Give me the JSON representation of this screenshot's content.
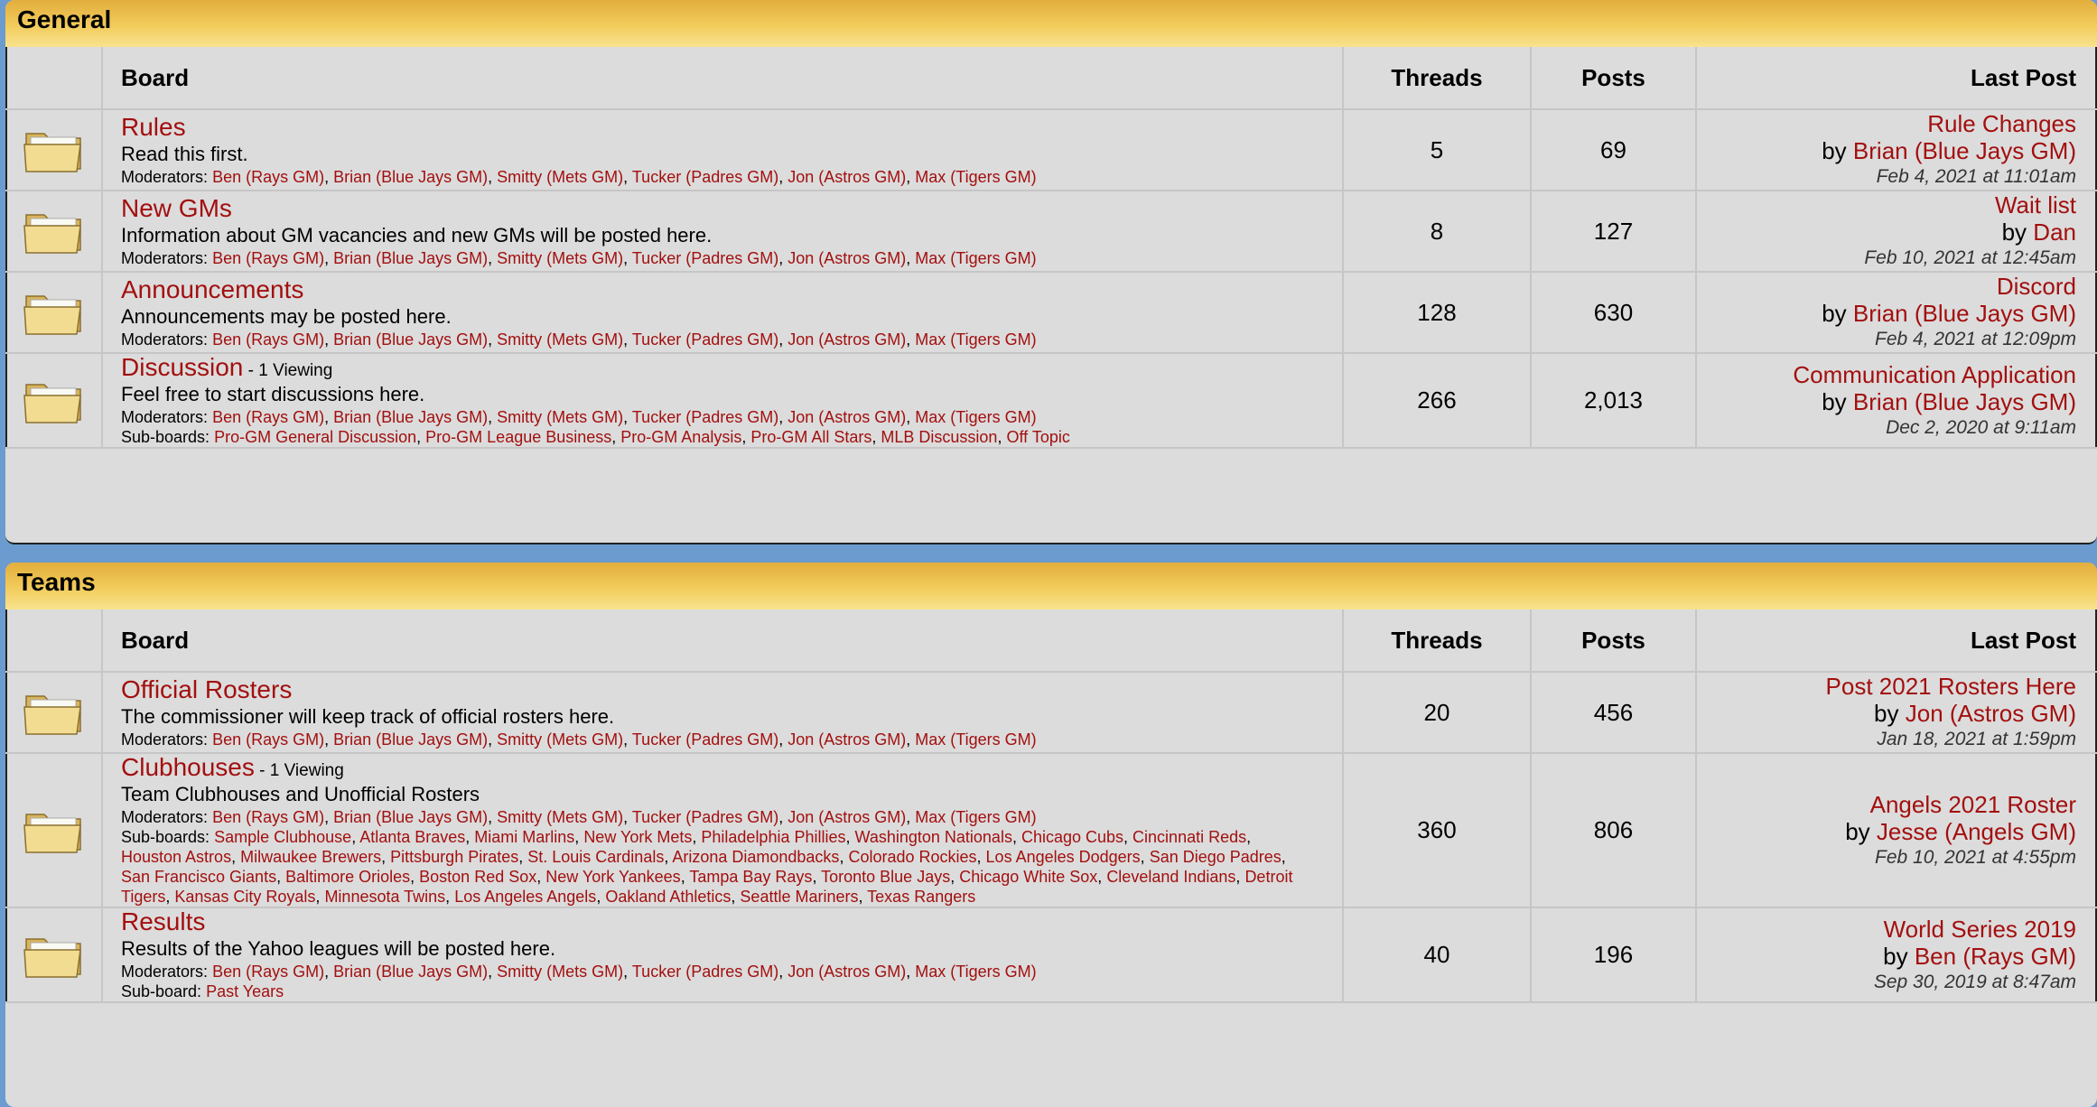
{
  "colors": {
    "link": "#a30f0f",
    "header_gold": "#f2cc5c",
    "background_blue": "#6b9bcf",
    "table_gray": "#dcdcdc"
  },
  "icons": {
    "board_icon": "folder-icon"
  },
  "labels": {
    "board": "Board",
    "threads": "Threads",
    "posts": "Posts",
    "last_post": "Last Post",
    "by": "by",
    "moderators": "Moderators:",
    "subboards": "Sub-boards:",
    "subboard": "Sub-board:"
  },
  "categories": [
    {
      "title": "General",
      "boards": [
        {
          "title": "Rules",
          "viewing": "",
          "description": "Read this first.",
          "moderators": [
            "Ben (Rays GM)",
            "Brian (Blue Jays GM)",
            "Smitty (Mets GM)",
            "Tucker (Padres GM)",
            "Jon (Astros GM)",
            "Max (Tigers GM)"
          ],
          "subboards_label": "",
          "subboards": [],
          "threads": "5",
          "posts": "69",
          "last_post": {
            "title": "Rule Changes",
            "author": "Brian (Blue Jays GM)",
            "date": "Feb 4, 2021 at 11:01am"
          }
        },
        {
          "title": "New GMs",
          "viewing": "",
          "description": "Information about GM vacancies and new GMs will be posted here.",
          "moderators": [
            "Ben (Rays GM)",
            "Brian (Blue Jays GM)",
            "Smitty (Mets GM)",
            "Tucker (Padres GM)",
            "Jon (Astros GM)",
            "Max (Tigers GM)"
          ],
          "subboards_label": "",
          "subboards": [],
          "threads": "8",
          "posts": "127",
          "last_post": {
            "title": "Wait list",
            "author": "Dan",
            "date": "Feb 10, 2021 at 12:45am"
          }
        },
        {
          "title": "Announcements",
          "viewing": "",
          "description": "Announcements may be posted here.",
          "moderators": [
            "Ben (Rays GM)",
            "Brian (Blue Jays GM)",
            "Smitty (Mets GM)",
            "Tucker (Padres GM)",
            "Jon (Astros GM)",
            "Max (Tigers GM)"
          ],
          "subboards_label": "",
          "subboards": [],
          "threads": "128",
          "posts": "630",
          "last_post": {
            "title": "Discord",
            "author": "Brian (Blue Jays GM)",
            "date": "Feb 4, 2021 at 12:09pm"
          }
        },
        {
          "title": "Discussion",
          "viewing": " - 1 Viewing",
          "description": "Feel free to start discussions here.",
          "moderators": [
            "Ben (Rays GM)",
            "Brian (Blue Jays GM)",
            "Smitty (Mets GM)",
            "Tucker (Padres GM)",
            "Jon (Astros GM)",
            "Max (Tigers GM)"
          ],
          "subboards_label": "Sub-boards:",
          "subboards": [
            "Pro-GM General Discussion",
            "Pro-GM League Business",
            "Pro-GM Analysis",
            "Pro-GM All Stars",
            "MLB Discussion",
            "Off Topic"
          ],
          "threads": "266",
          "posts": "2,013",
          "last_post": {
            "title": "Communication Application",
            "author": "Brian (Blue Jays GM)",
            "date": "Dec 2, 2020 at 9:11am"
          }
        }
      ]
    },
    {
      "title": "Teams",
      "boards": [
        {
          "title": "Official Rosters",
          "viewing": "",
          "description": "The commissioner will keep track of official rosters here.",
          "moderators": [
            "Ben (Rays GM)",
            "Brian (Blue Jays GM)",
            "Smitty (Mets GM)",
            "Tucker (Padres GM)",
            "Jon (Astros GM)",
            "Max (Tigers GM)"
          ],
          "subboards_label": "",
          "subboards": [],
          "threads": "20",
          "posts": "456",
          "last_post": {
            "title": "Post 2021 Rosters Here",
            "author": "Jon (Astros GM)",
            "date": "Jan 18, 2021 at 1:59pm"
          }
        },
        {
          "title": "Clubhouses",
          "viewing": " - 1 Viewing",
          "description": "Team Clubhouses and Unofficial Rosters",
          "moderators": [
            "Ben (Rays GM)",
            "Brian (Blue Jays GM)",
            "Smitty (Mets GM)",
            "Tucker (Padres GM)",
            "Jon (Astros GM)",
            "Max (Tigers GM)"
          ],
          "subboards_label": "Sub-boards:",
          "subboards": [
            "Sample Clubhouse",
            "Atlanta Braves",
            "Miami Marlins",
            "New York Mets",
            "Philadelphia Phillies",
            "Washington Nationals",
            "Chicago Cubs",
            "Cincinnati Reds",
            "Houston Astros",
            "Milwaukee Brewers",
            "Pittsburgh Pirates",
            "St. Louis Cardinals",
            "Arizona Diamondbacks",
            "Colorado Rockies",
            "Los Angeles Dodgers",
            "San Diego Padres",
            "San Francisco Giants",
            "Baltimore Orioles",
            "Boston Red Sox",
            "New York Yankees",
            "Tampa Bay Rays",
            "Toronto Blue Jays",
            "Chicago White Sox",
            "Cleveland Indians",
            "Detroit Tigers",
            "Kansas City Royals",
            "Minnesota Twins",
            "Los Angeles Angels",
            "Oakland Athletics",
            "Seattle Mariners",
            "Texas Rangers"
          ],
          "threads": "360",
          "posts": "806",
          "last_post": {
            "title": "Angels 2021 Roster",
            "author": "Jesse (Angels GM)",
            "date": "Feb 10, 2021 at 4:55pm"
          }
        },
        {
          "title": "Results",
          "viewing": "",
          "description": "Results of the Yahoo leagues will be posted here.",
          "moderators": [
            "Ben (Rays GM)",
            "Brian (Blue Jays GM)",
            "Smitty (Mets GM)",
            "Tucker (Padres GM)",
            "Jon (Astros GM)",
            "Max (Tigers GM)"
          ],
          "subboards_label": "Sub-board:",
          "subboards": [
            "Past Years"
          ],
          "threads": "40",
          "posts": "196",
          "last_post": {
            "title": "World Series 2019",
            "author": "Ben (Rays GM)",
            "date": "Sep 30, 2019 at 8:47am"
          }
        }
      ]
    }
  ]
}
